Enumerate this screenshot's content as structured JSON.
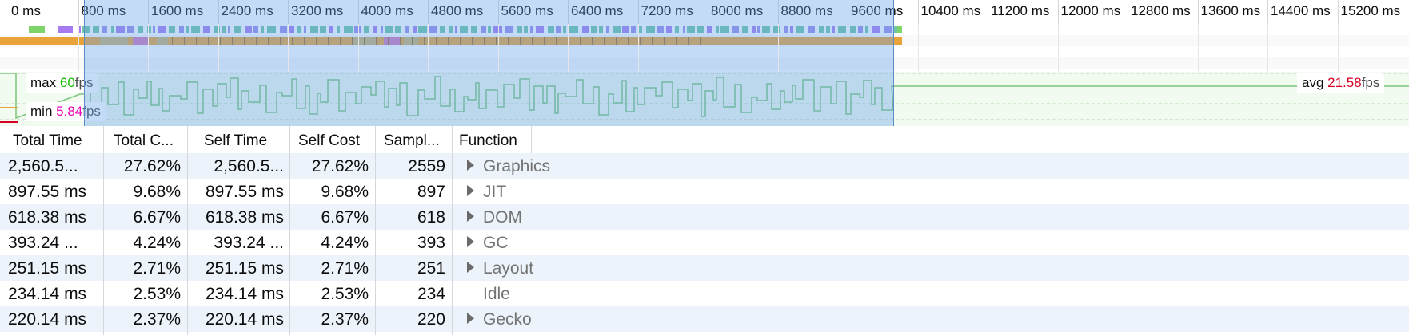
{
  "timeline": {
    "ticks": [
      "0 ms",
      "800 ms",
      "1600 ms",
      "2400 ms",
      "3200 ms",
      "4000 ms",
      "4800 ms",
      "5600 ms",
      "6400 ms",
      "7200 ms",
      "8000 ms",
      "8800 ms",
      "9600 ms",
      "10400 ms",
      "11200 ms",
      "12000 ms",
      "12800 ms",
      "13600 ms",
      "14400 ms",
      "15200 ms"
    ]
  },
  "fps": {
    "max_prefix": "max",
    "max_value": "60",
    "min_prefix": "min",
    "min_value": "5.84",
    "avg_prefix": "avg",
    "avg_value": "21.58",
    "unit": "fps",
    "max_color": "#12bc00",
    "min_color": "#ed00b5",
    "avg_color": "#d70022"
  },
  "call_tree": {
    "headers": {
      "total_time": "Total Time",
      "total_cost": "Total C...",
      "self_time": "Self Time",
      "self_cost": "Self Cost",
      "samples": "Sampl...",
      "function": "Function"
    },
    "rows": [
      {
        "total_time": "2,560.5...",
        "total_cost": "27.62%",
        "self_time": "2,560.5...",
        "self_cost": "27.62%",
        "samples": "2559",
        "function": "Graphics",
        "expandable": true
      },
      {
        "total_time": "897.55 ms",
        "total_cost": "9.68%",
        "self_time": "897.55 ms",
        "self_cost": "9.68%",
        "samples": "897",
        "function": "JIT",
        "expandable": true
      },
      {
        "total_time": "618.38 ms",
        "total_cost": "6.67%",
        "self_time": "618.38 ms",
        "self_cost": "6.67%",
        "samples": "618",
        "function": "DOM",
        "expandable": true
      },
      {
        "total_time": "393.24 ...",
        "total_cost": "4.24%",
        "self_time": "393.24 ...",
        "self_cost": "4.24%",
        "samples": "393",
        "function": "GC",
        "expandable": true
      },
      {
        "total_time": "251.15 ms",
        "total_cost": "2.71%",
        "self_time": "251.15 ms",
        "self_cost": "2.71%",
        "samples": "251",
        "function": "Layout",
        "expandable": true
      },
      {
        "total_time": "234.14 ms",
        "total_cost": "2.53%",
        "self_time": "234.14 ms",
        "self_cost": "2.53%",
        "samples": "234",
        "function": "Idle",
        "expandable": false
      },
      {
        "total_time": "220.14 ms",
        "total_cost": "2.37%",
        "self_time": "220.14 ms",
        "self_cost": "2.37%",
        "samples": "220",
        "function": "Gecko",
        "expandable": true
      }
    ]
  }
}
